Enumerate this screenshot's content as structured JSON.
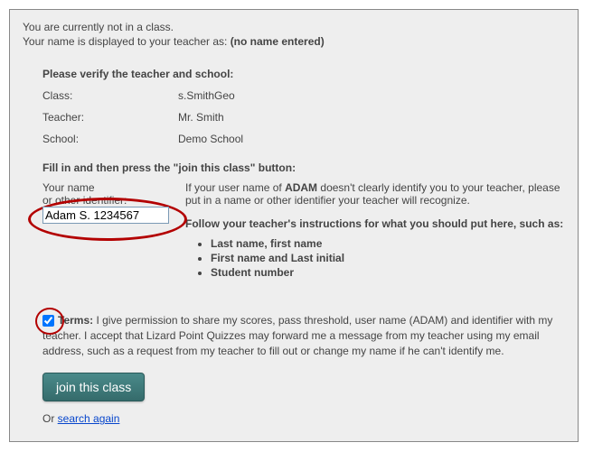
{
  "status": {
    "line1": "You are currently not in a class.",
    "line2_prefix": "Your name is displayed to your teacher as: ",
    "display_name": "(no name entered)"
  },
  "verify": {
    "heading": "Please verify the teacher and school:",
    "class_label": "Class:",
    "class_value": "s.SmithGeo",
    "teacher_label": "Teacher:",
    "teacher_value": "Mr. Smith",
    "school_label": "School:",
    "school_value": "Demo School"
  },
  "fill": {
    "heading": "Fill in and then press the \"join this class\" button:",
    "name_label_line1": "Your name",
    "name_label_line2": "or other identifier:",
    "name_input_value": "Adam S. 1234567",
    "instruction_prefix": "If your user name of ",
    "user_name": "ADAM",
    "instruction_suffix": " doesn't clearly identify you to your teacher, please put in a name or other identifier your teacher will recognize.",
    "follow_heading": "Follow your teacher's instructions for what you should put here, such as:",
    "suggestions": {
      "0": "Last name, first name",
      "1": "First name and Last initial",
      "2": "Student number"
    }
  },
  "terms": {
    "label": "Terms:",
    "text_part1": " I give permission to share my scores, pass threshold, user name (",
    "user_name": "ADAM",
    "text_part2": ") and identifier with my teacher. I accept that Lizard Point Quizzes may forward me a message from my teacher using my email address, such as a request from my teacher to fill out or change my name if he can't identify me."
  },
  "actions": {
    "join_label": "join this class",
    "or_text": "Or ",
    "search_again": "search again"
  }
}
